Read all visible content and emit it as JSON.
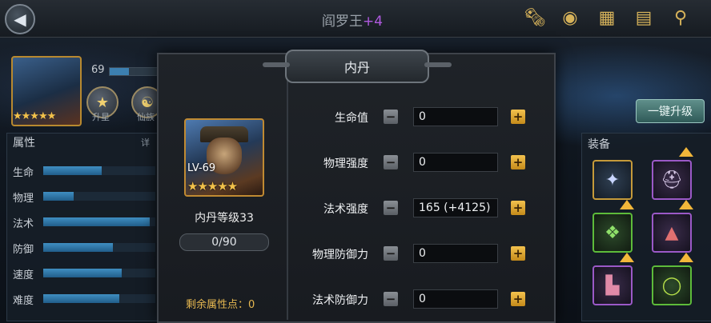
{
  "header": {
    "hero_name": "阎罗王",
    "hero_plus": "+4"
  },
  "left": {
    "level_num": "69",
    "star_up_label": "升星",
    "fate_label": "仙族",
    "attr_title": "属性",
    "detail_label": "详",
    "attributes": [
      {
        "label": "生命",
        "value": 0.52
      },
      {
        "label": "物理",
        "value": 0.27
      },
      {
        "label": "法术",
        "value": 0.95
      },
      {
        "label": "防御",
        "value": 0.62
      },
      {
        "label": "速度",
        "value": 0.7
      },
      {
        "label": "难度",
        "value": 0.68
      }
    ]
  },
  "right": {
    "one_key_upgrade": "一键升级",
    "equip_title": "装备"
  },
  "modal": {
    "title": "内丹",
    "hero_level": "LV-69",
    "stars": "★★★★★",
    "neidan_level": "内丹等级33",
    "progress": "0/90",
    "remaining_points": "剩余属性点：0",
    "stats": [
      {
        "label": "生命值",
        "value": "0"
      },
      {
        "label": "物理强度",
        "value": "0"
      },
      {
        "label": "法术强度",
        "value": "165 (+4125)"
      },
      {
        "label": "物理防御力",
        "value": "0"
      },
      {
        "label": "法术防御力",
        "value": "0"
      }
    ]
  },
  "icons": [
    "back-arrow-icon",
    "scroll-icon",
    "coin-icon",
    "map-icon",
    "book-icon",
    "magnifier-icon"
  ]
}
